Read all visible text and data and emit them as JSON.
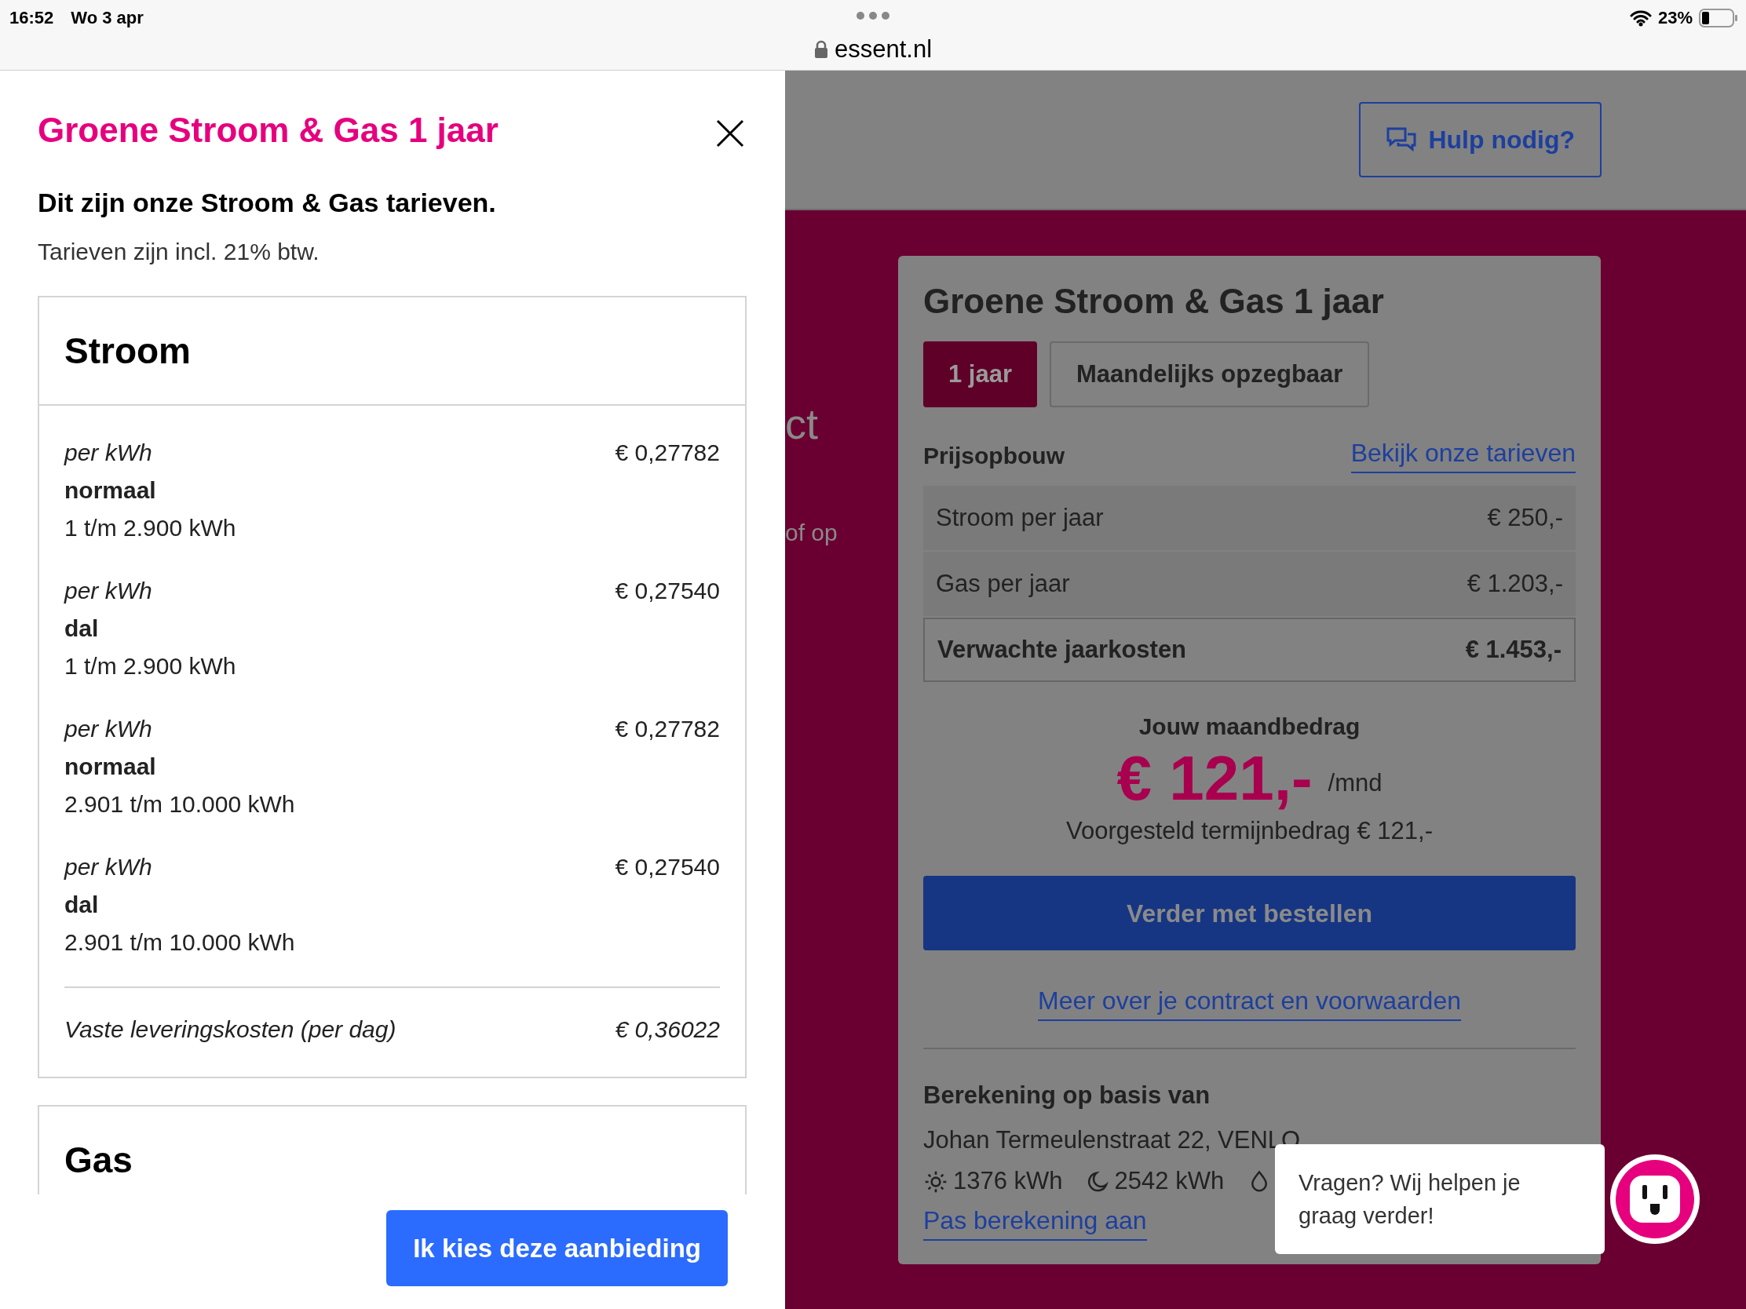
{
  "status_bar": {
    "time": "16:52",
    "date": "Wo 3 apr",
    "url": "essent.nl",
    "battery": "23%"
  },
  "drawer": {
    "title": "Groene Stroom & Gas 1 jaar",
    "heading": "Dit zijn onze Stroom & Gas tarieven.",
    "subtitle": "Tarieven zijn incl. 21% btw.",
    "sections": [
      {
        "title": "Stroom",
        "rates": [
          {
            "unit": "per kWh",
            "type": "normaal",
            "range": "1 t/m 2.900 kWh",
            "price": "€ 0,27782"
          },
          {
            "unit": "per kWh",
            "type": "dal",
            "range": "1 t/m 2.900 kWh",
            "price": "€ 0,27540"
          },
          {
            "unit": "per kWh",
            "type": "normaal",
            "range": "2.901 t/m 10.000 kWh",
            "price": "€ 0,27782"
          },
          {
            "unit": "per kWh",
            "type": "dal",
            "range": "2.901 t/m 10.000 kWh",
            "price": "€ 0,27540"
          }
        ],
        "fixed": {
          "label": "Vaste leveringskosten (per dag)",
          "price": "€ 0,36022"
        }
      },
      {
        "title": "Gas"
      }
    ],
    "button": "Ik kies deze aanbieding"
  },
  "page": {
    "help_button": "Hulp nodig?",
    "partial_texts": [
      "ct",
      "of op"
    ],
    "card": {
      "title": "Groene Stroom & Gas 1 jaar",
      "tabs": [
        {
          "label": "1 jaar",
          "selected": true
        },
        {
          "label": "Maandelijks opzegbaar",
          "selected": false
        }
      ],
      "breakdown_title": "Prijsopbouw",
      "tariffs_link": "Bekijk onze tarieven",
      "rows": [
        {
          "kind": "item",
          "label": "Stroom per jaar",
          "value": "€ 250,-"
        },
        {
          "kind": "item",
          "label": "Gas per jaar",
          "value": "€ 1.203,-"
        },
        {
          "kind": "total",
          "label": "Verwachte jaarkosten",
          "value": "€ 1.453,-"
        }
      ],
      "monthly_label": "Jouw maandbedrag",
      "monthly_amount": "€ 121,-",
      "monthly_unit": "/mnd",
      "suggested": "Voorgesteld termijnbedrag € 121,-",
      "order_button": "Verder met bestellen",
      "contract_link": "Meer over je contract en voorwaarden",
      "calc_title": "Berekening op basis van",
      "address": "Johan Termeulenstraat 22, VENLO",
      "usage": [
        {
          "kind": "day",
          "value": "1376 kWh"
        },
        {
          "kind": "night",
          "value": "2542 kWh"
        },
        {
          "kind": "gas"
        }
      ],
      "adjust_link": "Pas berekening aan"
    }
  },
  "chat": {
    "message": "Vragen? Wij helpen je graag verder!"
  }
}
